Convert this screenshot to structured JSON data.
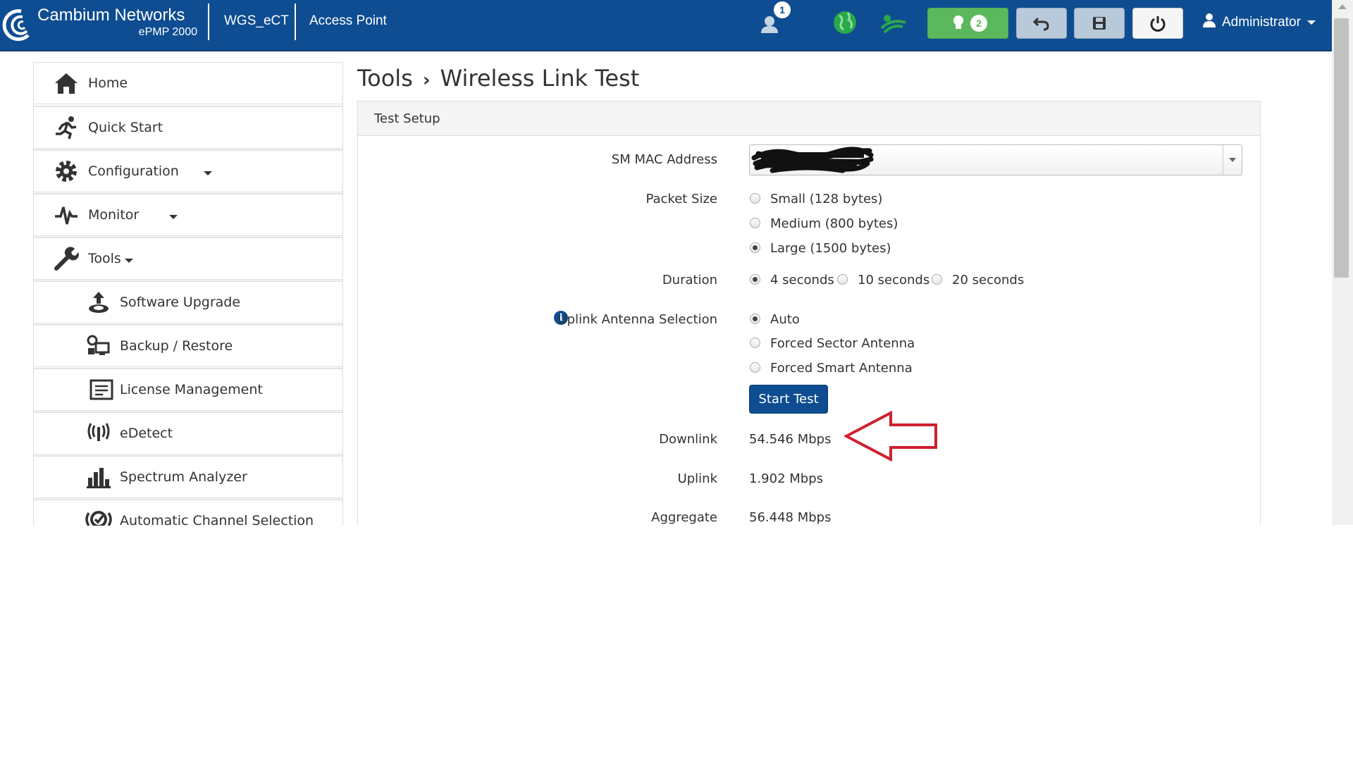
{
  "brand": {
    "name": "Cambium Networks",
    "model": "ePMP 2000"
  },
  "navbar": {
    "device_name": "WGS_eCT",
    "mode": "Access Point",
    "user_badge": "1",
    "alerts_badge": "2",
    "user_menu": "Administrator",
    "icons": [
      "users-icon",
      "globe-icon",
      "wireless-icon",
      "lightbulb-icon",
      "undo-icon",
      "save-icon",
      "power-icon",
      "person-icon"
    ]
  },
  "sidebar": {
    "items": [
      {
        "label": "Home",
        "icon": "home-icon"
      },
      {
        "label": "Quick Start",
        "icon": "running-icon"
      },
      {
        "label": "Configuration",
        "icon": "gear-icon"
      },
      {
        "label": "Monitor",
        "icon": "pulse-icon"
      },
      {
        "label": "Tools",
        "icon": "wrench-icon"
      },
      {
        "label": "Software Upgrade",
        "icon": "upload-icon"
      },
      {
        "label": "Backup / Restore",
        "icon": "backup-icon"
      },
      {
        "label": "License Management",
        "icon": "license-icon"
      },
      {
        "label": "eDetect",
        "icon": "edetect-icon"
      },
      {
        "label": "Spectrum Analyzer",
        "icon": "bar-chart-icon"
      },
      {
        "label": "Automatic Channel Selection",
        "icon": "channel-icon"
      }
    ]
  },
  "breadcrumb": {
    "section": "Tools",
    "page": "Wireless Link Test"
  },
  "panel": {
    "title": "Test Setup",
    "mac_label": "SM MAC Address",
    "packet_size_label": "Packet Size",
    "packet_sizes": [
      "Small (128 bytes)",
      "Medium (800 bytes)",
      "Large (1500 bytes)"
    ],
    "packet_size_selected": "Large (1500 bytes)",
    "duration_label": "Duration",
    "durations": [
      "4 seconds",
      "10 seconds",
      "20 seconds"
    ],
    "duration_selected": "4 seconds",
    "antenna_label": "Uplink Antenna Selection",
    "antennas": [
      "Auto",
      "Forced Sector Antenna",
      "Forced Smart Antenna"
    ],
    "antenna_selected": "Auto",
    "start_button": "Start Test",
    "results": {
      "downlink_label": "Downlink",
      "downlink_value": "54.546 Mbps",
      "uplink_label": "Uplink",
      "uplink_value": "1.902 Mbps",
      "aggregate_label": "Aggregate",
      "aggregate_value": "56.448 Mbps"
    }
  },
  "colors": {
    "navbar": "#0e4d91",
    "alerts_button": "#5cb85c",
    "annotation_arrow": "#d0202e"
  }
}
